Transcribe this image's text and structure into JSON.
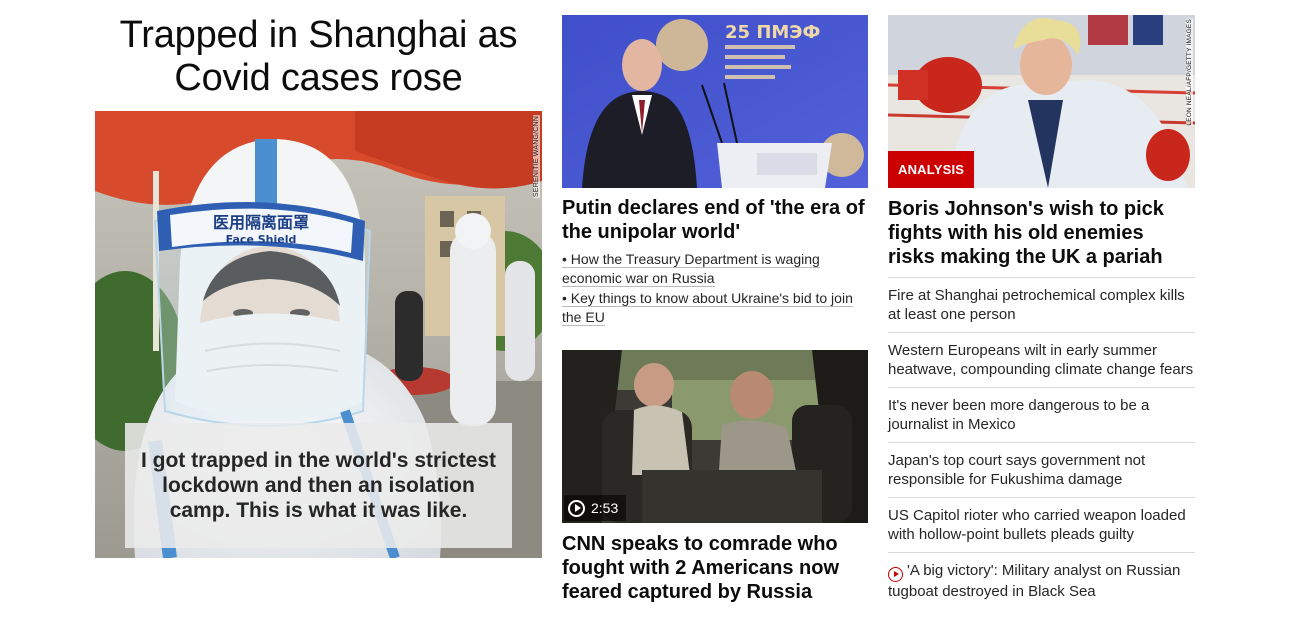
{
  "col1": {
    "headline": "Trapped in Shanghai as Covid cases rose",
    "image_credit": "SERENITIE WANG/CNN",
    "image_text": {
      "shield_cn": "医用隔离面罩",
      "shield_en": "Face Shield"
    },
    "caption": "I got trapped in the world's strictest lockdown and then an isolation camp. This is what it was like."
  },
  "col2": {
    "story1": {
      "title": "Putin declares end of 'the era of the unipolar world'",
      "image_text": "25 ПМЭФ",
      "related": [
        "• How the Treasury Department is waging economic war on Russia",
        "• Key things to know about Ukraine's bid to join the EU"
      ]
    },
    "story2": {
      "title": "CNN speaks to comrade who fought with 2 Americans now feared captured by Russia",
      "duration": "2:53",
      "icon": "play-circle-icon"
    }
  },
  "col3": {
    "lead": {
      "tag": "ANALYSIS",
      "image_credit": "LEON NEAL/AFP/GETTY IMAGES",
      "title": "Boris Johnson's wish to pick fights with his old enemies risks making the UK a pariah"
    },
    "headlines": [
      {
        "text": "Fire at Shanghai petrochemical complex kills at least one person",
        "video": false
      },
      {
        "text": "Western Europeans wilt in early summer heatwave, compounding climate change fears",
        "video": false
      },
      {
        "text": "It's never been more dangerous to be a journalist in Mexico",
        "video": false
      },
      {
        "text": "Japan's top court says government not responsible for Fukushima damage",
        "video": false
      },
      {
        "text": "US Capitol rioter who carried weapon loaded with hollow-point bullets pleads guilty",
        "video": false
      },
      {
        "text": "'A big victory': Military analyst on Russian tugboat destroyed in Black Sea",
        "video": true
      }
    ]
  },
  "colors": {
    "accent_red": "#cc0000",
    "text": "#0c0c0c"
  }
}
